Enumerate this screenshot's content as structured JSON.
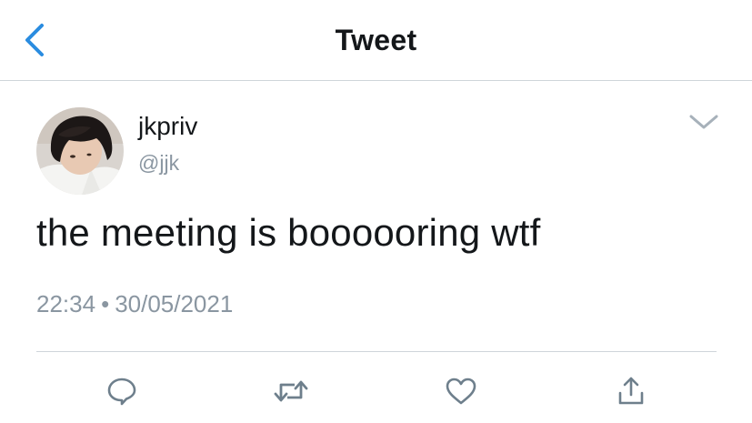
{
  "header": {
    "title": "Tweet",
    "back_icon": "chevron-left-icon"
  },
  "tweet": {
    "display_name": "jkpriv",
    "handle": "@jjk",
    "text": "the meeting is boooooring wtf",
    "time": "22:34",
    "separator": "•",
    "date": "30/05/2021",
    "more_icon": "chevron-down-icon"
  },
  "actions": {
    "reply_icon": "reply-icon",
    "retweet_icon": "retweet-icon",
    "like_icon": "heart-icon",
    "share_icon": "share-icon"
  },
  "colors": {
    "accent": "#1da1f2",
    "text": "#14171a",
    "secondary": "#8a96a1",
    "icon": "#6e7f8c",
    "divider": "#cfd5da"
  }
}
